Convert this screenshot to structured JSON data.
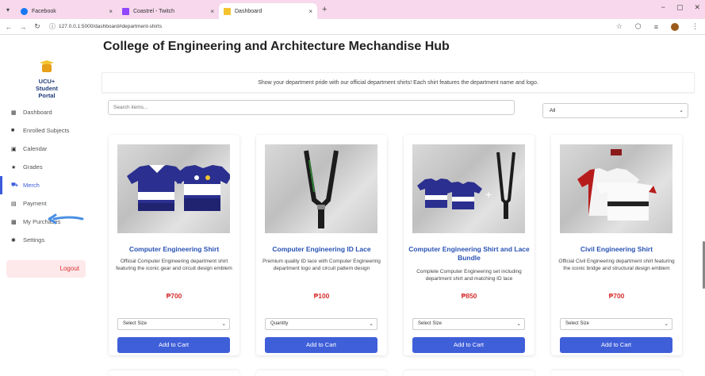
{
  "browser": {
    "tabs": [
      {
        "label": "Facebook",
        "icon": "facebook-icon",
        "color": "#1877f2"
      },
      {
        "label": "Coastrel - Twitch",
        "icon": "twitch-icon",
        "color": "#9146ff"
      },
      {
        "label": "Dashboard",
        "icon": "dashboard-favicon",
        "color": "#f4c430"
      }
    ],
    "url": "127.0.0.1:5000/dashboard#department-shirts"
  },
  "sidebar": {
    "portal_lines": [
      "UCU+",
      "Student",
      "Portal"
    ],
    "items": [
      {
        "label": "Dashboard",
        "icon": "grid-icon",
        "glyph": "▦"
      },
      {
        "label": "Enrolled Subjects",
        "icon": "book-icon",
        "glyph": "■"
      },
      {
        "label": "Calendar",
        "icon": "calendar-icon",
        "glyph": "▣"
      },
      {
        "label": "Grades",
        "icon": "star-icon",
        "glyph": "★"
      },
      {
        "label": "Merch",
        "icon": "cart-icon",
        "glyph": "⛟"
      },
      {
        "label": "Payment",
        "icon": "card-icon",
        "glyph": "▤"
      },
      {
        "label": "My Purchases",
        "icon": "receipt-icon",
        "glyph": "▩"
      },
      {
        "label": "Settings",
        "icon": "gear-icon",
        "glyph": "✱"
      }
    ],
    "active_index": 4,
    "logout_label": "Logout"
  },
  "main": {
    "title": "College of Engineering and Architecture Mechandise Hub",
    "intro": "Show your department pride with our official department shirts! Each shirt features the department name and logo.",
    "search_placeholder": "Search items...",
    "filter_value": "All",
    "products": [
      {
        "name": "Computer Engineering Shirt",
        "description": "Official Computer Engineering department shirt featuring the iconic gear and circuit design emblem",
        "price": "₱700",
        "select_label": "Select Size",
        "add_label": "Add to Cart",
        "image": "ce-shirt"
      },
      {
        "name": "Computer Engineering ID Lace",
        "description": "Premium quality ID lace with Computer Engineering department logo and circuit pattern design",
        "price": "₱100",
        "select_label": "Quantity",
        "add_label": "Add to Cart",
        "image": "ce-lace"
      },
      {
        "name": "Computer Engineering Shirt and Lace Bundle",
        "description": "Complete Computer Engineering set including department shirt and matching ID lace",
        "price": "₱850",
        "select_label": "Select Size",
        "add_label": "Add to Cart",
        "image": "ce-bundle"
      },
      {
        "name": "Civil Engineering Shirt",
        "description": "Official Civil Engineering department shirt featuring the iconic bridge and structural design emblem",
        "price": "₱700",
        "select_label": "Select Size",
        "add_label": "Add to Cart",
        "image": "civil-shirt"
      }
    ]
  },
  "colors": {
    "accent": "#3f5fd9",
    "price": "#d63031",
    "product_name": "#2952b3",
    "tabbar": "#f7d8ec"
  }
}
